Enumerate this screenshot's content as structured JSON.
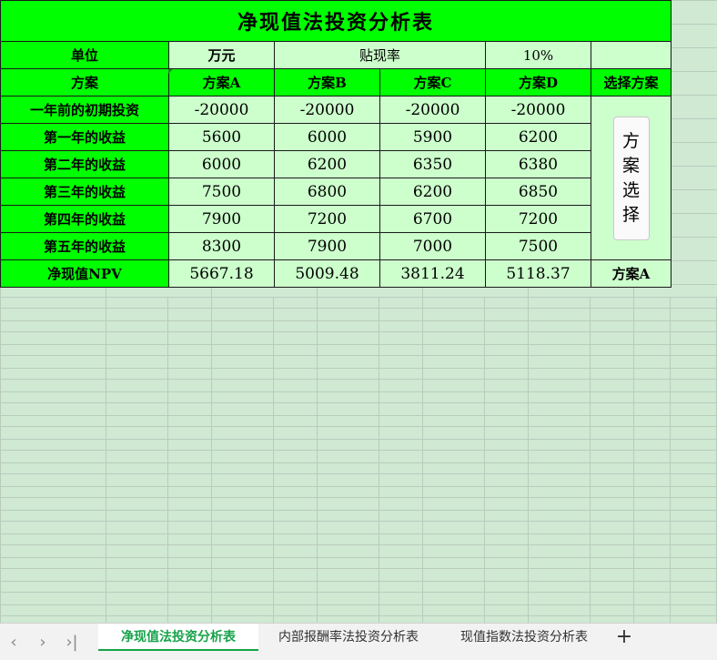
{
  "sheet": {
    "title": "净现值法投资分析表",
    "unit_label": "单位",
    "unit_value": "万元",
    "rate_label": "贴现率",
    "rate_value": "10%",
    "header_plan": "方案",
    "plans": [
      "方案A",
      "方案B",
      "方案C",
      "方案D"
    ],
    "select_header": "选择方案",
    "rows": [
      {
        "label": "一年前的初期投资",
        "values": [
          "-20000",
          "-20000",
          "-20000",
          "-20000"
        ]
      },
      {
        "label": "第一年的收益",
        "values": [
          "5600",
          "6000",
          "5900",
          "6200"
        ]
      },
      {
        "label": "第二年的收益",
        "values": [
          "6000",
          "6200",
          "6350",
          "6380"
        ]
      },
      {
        "label": "第三年的收益",
        "values": [
          "7500",
          "6800",
          "6200",
          "6850"
        ]
      },
      {
        "label": "第四年的收益",
        "values": [
          "7900",
          "7200",
          "6700",
          "7200"
        ]
      },
      {
        "label": "第五年的收益",
        "values": [
          "8300",
          "7900",
          "7000",
          "7500"
        ]
      }
    ],
    "npv_label": "净现值NPV",
    "npv_values": [
      "5667.18",
      "5009.48",
      "3811.24",
      "5118.37"
    ],
    "chosen": "方案A",
    "select_button": [
      "方",
      "案",
      "选",
      "择"
    ]
  },
  "tabs": {
    "items": [
      "净现值法投资分析表",
      "内部报酬率法投资分析表",
      "现值指数法投资分析表"
    ],
    "active_index": 0,
    "add_label": "+"
  },
  "colors": {
    "header_green": "#00ff00",
    "cell_light_green": "#ccffcc",
    "background": "#cfe9d3",
    "active_tab": "#16a34a"
  }
}
